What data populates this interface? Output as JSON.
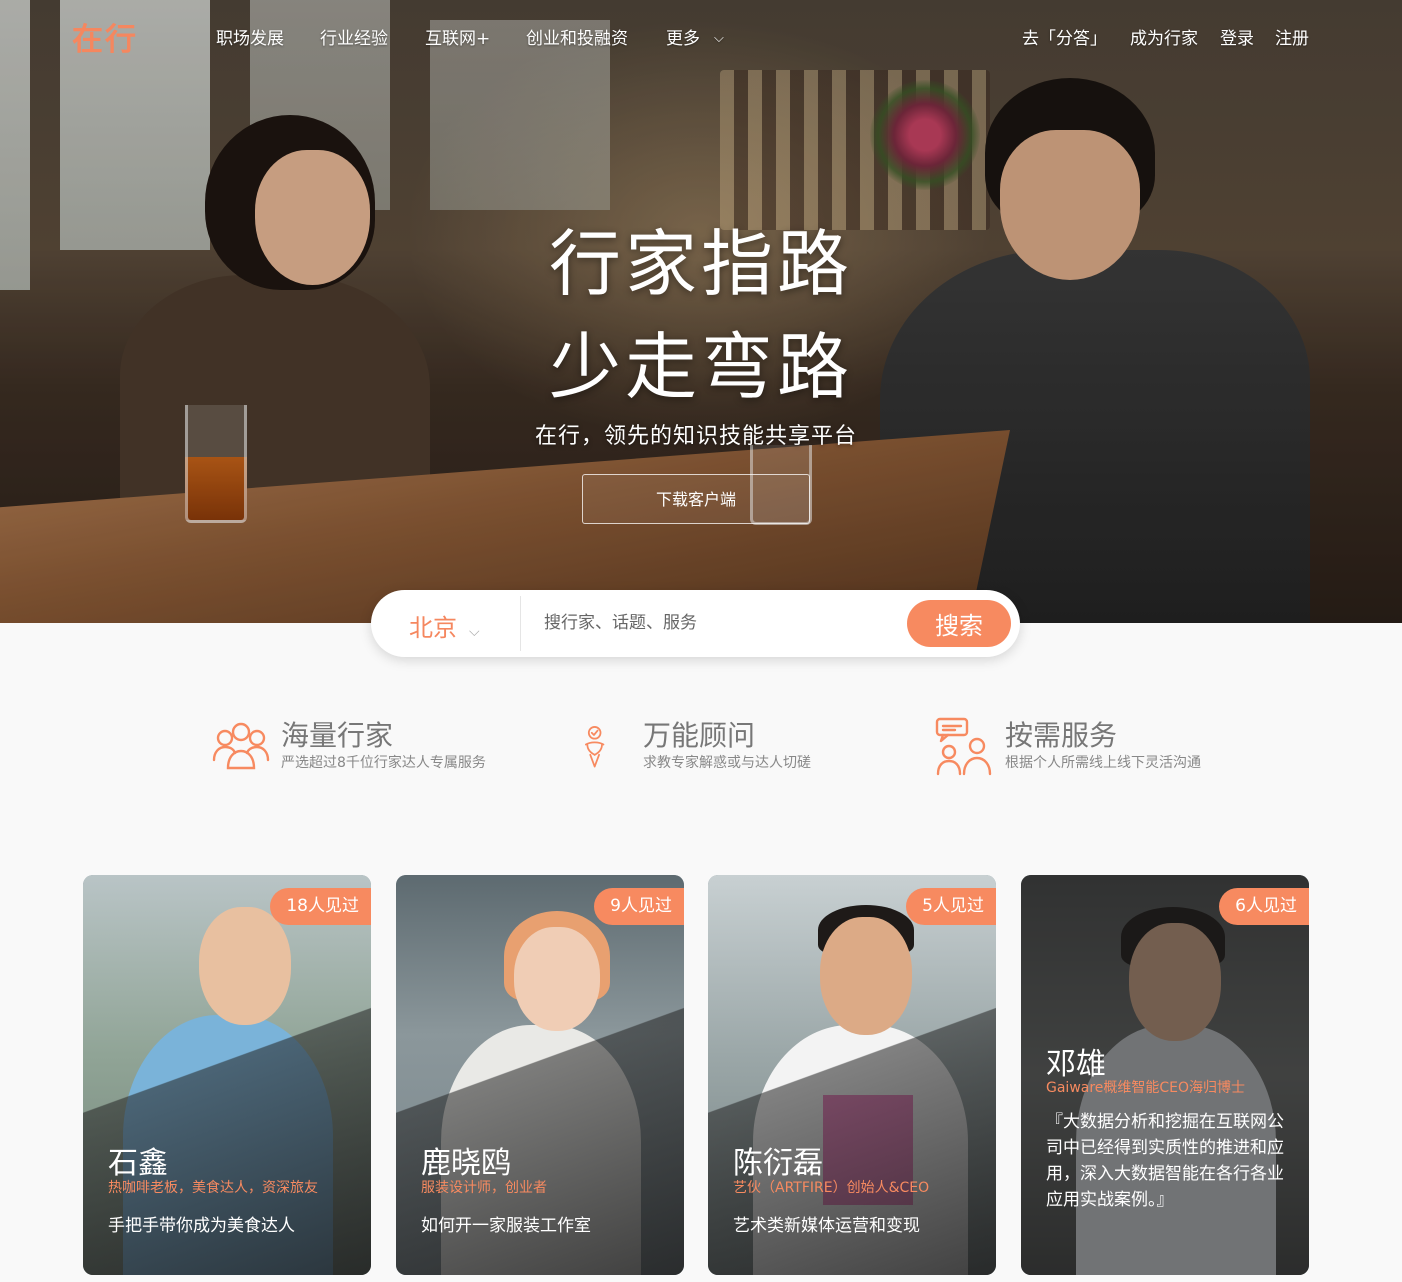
{
  "brand": {
    "logo": "在行",
    "accent": "#f78a60"
  },
  "nav": {
    "left": [
      "职场发展",
      "行业经验",
      "互联网+",
      "创业和投融资",
      "更多"
    ],
    "more_icon": "chevron-down-icon",
    "right": [
      "去「分答」",
      "成为行家",
      "登录",
      "注册"
    ]
  },
  "hero": {
    "headline_1": "行家指路",
    "headline_2": "少走弯路",
    "subtitle": "在行，领先的知识技能共享平台",
    "download_label": "下载客户端"
  },
  "search": {
    "city": "北京",
    "city_icon": "chevron-down-icon",
    "placeholder": "搜行家、话题、服务",
    "button_label": "搜索"
  },
  "features": [
    {
      "icon": "people-group-icon",
      "title": "海量行家",
      "desc": "严选超过8千位行家达人专属服务"
    },
    {
      "icon": "advisor-icon",
      "title": "万能顾问",
      "desc": "求教专家解惑或与达人切磋"
    },
    {
      "icon": "chat-service-icon",
      "title": "按需服务",
      "desc": "根据个人所需线上线下灵活沟通"
    }
  ],
  "experts": [
    {
      "count": "18人见过",
      "name": "石鑫",
      "role": "热咖啡老板，美食达人，资深旅友",
      "topic": "手把手带你成为美食达人"
    },
    {
      "count": "9人见过",
      "name": "鹿晓鸥",
      "role": "服装设计师，创业者",
      "topic": "如何开一家服装工作室"
    },
    {
      "count": "5人见过",
      "name": "陈衍磊",
      "role": "艺伙（ARTFIRE）创始人&CEO",
      "topic": "艺术类新媒体运营和变现"
    },
    {
      "count": "6人见过",
      "name": "邓雄",
      "role": "Gaiware概维智能CEO海归博士",
      "quote": "『大数据分析和挖掘在互联网公司中已经得到实质性的推进和应用，深入大数据智能在各行各业应用实战案例。』"
    }
  ]
}
